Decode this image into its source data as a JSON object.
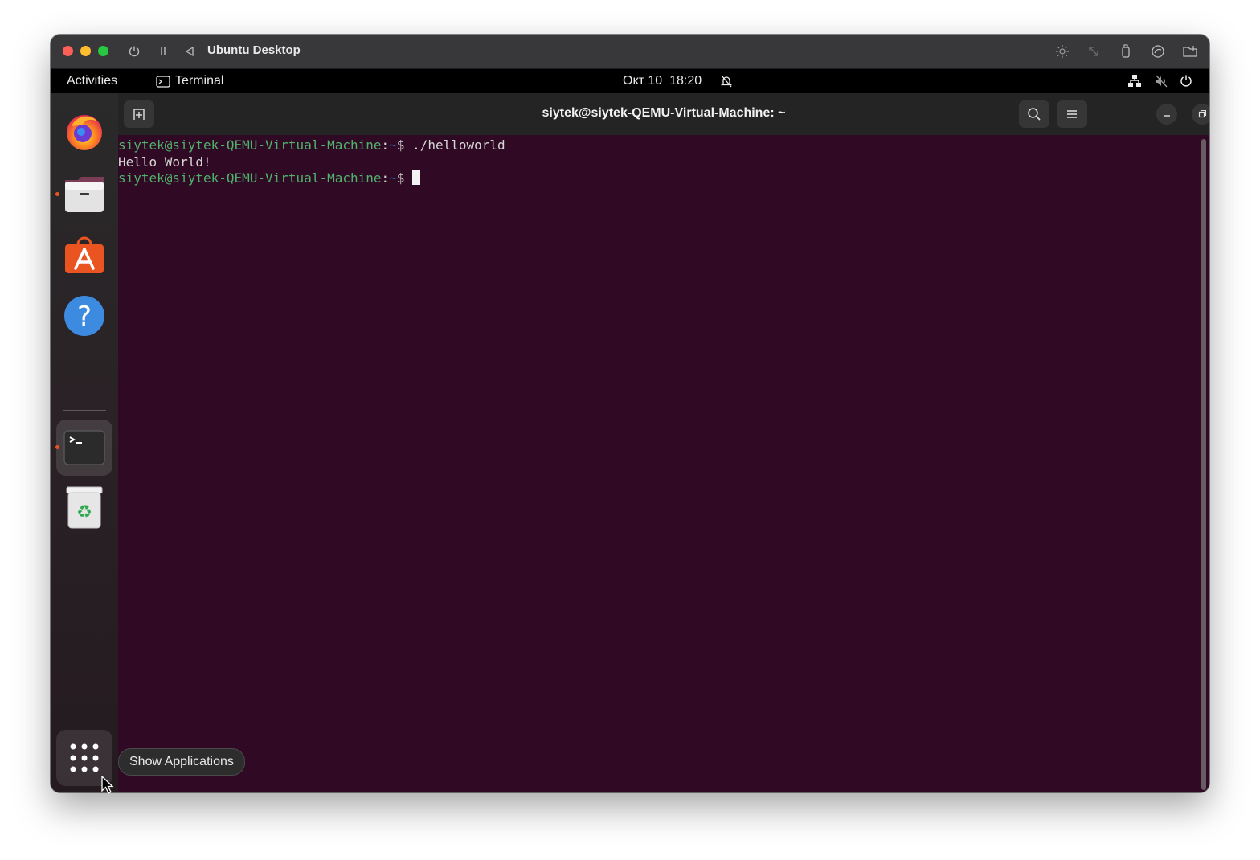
{
  "vm": {
    "title": "Ubuntu Desktop"
  },
  "topbar": {
    "activities": "Activities",
    "app_name": "Terminal",
    "clock": "Окт 10  18:20"
  },
  "dock": {
    "items": [
      {
        "name": "Firefox"
      },
      {
        "name": "Files"
      },
      {
        "name": "Ubuntu Software"
      },
      {
        "name": "Help"
      },
      {
        "name": "Terminal"
      },
      {
        "name": "Trash"
      }
    ],
    "show_apps_tooltip": "Show Applications"
  },
  "terminal": {
    "title": "siytek@siytek-QEMU-Virtual-Machine: ~",
    "lines": [
      {
        "user": "siytek@siytek-QEMU-Virtual-Machine",
        "path": "~",
        "command": " ./helloworld"
      },
      {
        "output": "Hello World!"
      },
      {
        "user": "siytek@siytek-QEMU-Virtual-Machine",
        "path": "~",
        "command": " "
      }
    ]
  },
  "colors": {
    "terminal_bg": "#300a24",
    "prompt_user": "#4fb36c",
    "prompt_path": "#3465a4",
    "accent": "#e95420"
  }
}
